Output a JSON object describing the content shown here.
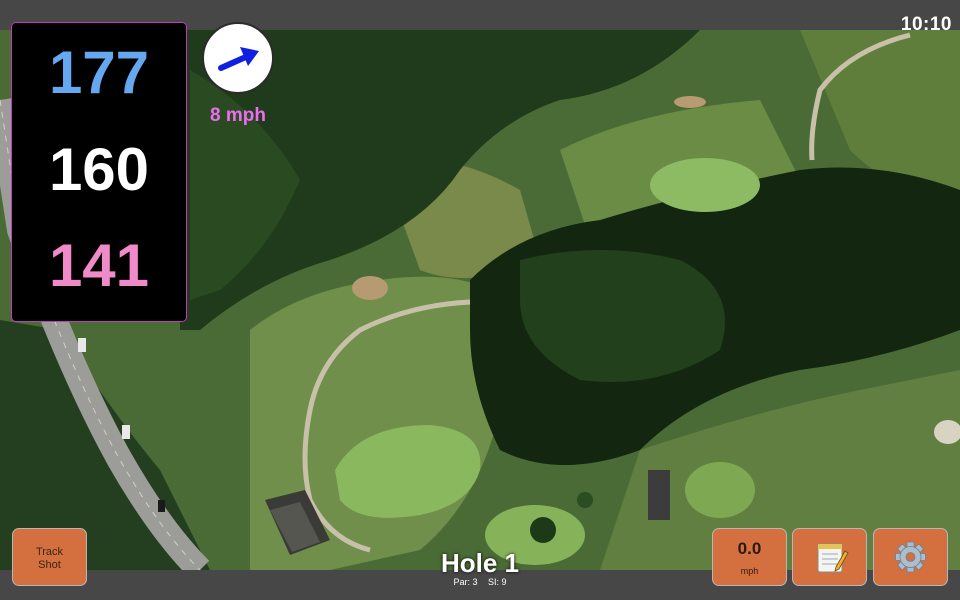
{
  "status": {
    "clock": "10:10"
  },
  "distances": {
    "back": "177",
    "middle": "160",
    "front": "141",
    "colors": {
      "back": "#66a8f0",
      "middle": "#ffffff",
      "front": "#f18ac8"
    }
  },
  "wind": {
    "speed_label": "8 mph",
    "arrow_icon": "wind-direction-arrow-icon",
    "arrow_color": "#1020e0",
    "label_color": "#ee6cf0"
  },
  "buttons": {
    "track_shot": "Track\nShot",
    "wind_value": "0.0",
    "wind_unit": "mph",
    "notes_icon": "notepad-icon",
    "settings_icon": "gear-icon",
    "accent": "#d4703f"
  },
  "hole": {
    "title": "Hole 1",
    "par": "Par: 3",
    "si": "SI: 9"
  },
  "map": {
    "type": "satellite-golf-course-map"
  }
}
